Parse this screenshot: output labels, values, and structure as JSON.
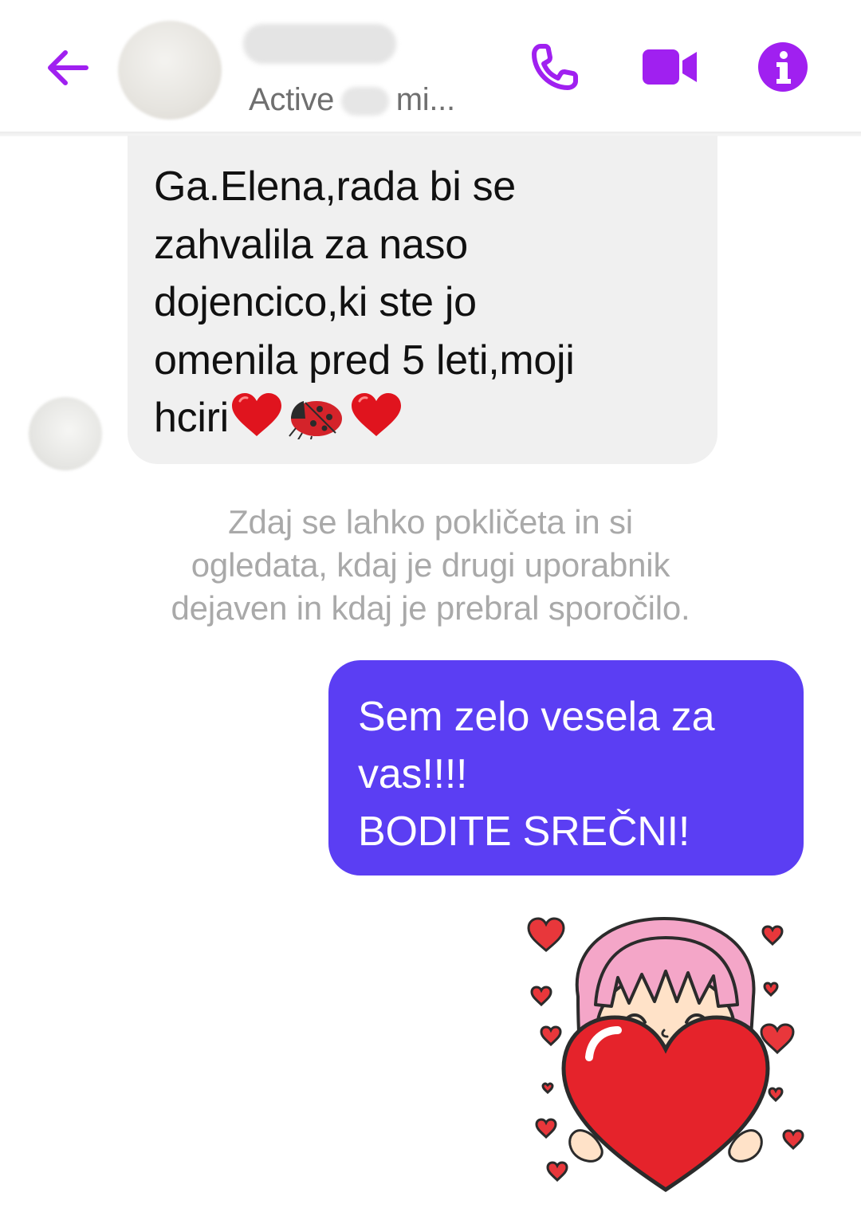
{
  "header": {
    "status_prefix": "Active ",
    "status_suffix": " mi...",
    "icons": [
      "back-arrow-icon",
      "phone-icon",
      "video-camera-icon",
      "info-icon"
    ]
  },
  "colors": {
    "accent": "#a020f0",
    "outgoing_bubble": "#5b3ef3",
    "incoming_bubble": "#f0f0f0",
    "notice_text": "#a9a9a9"
  },
  "messages": {
    "incoming": {
      "text": "Ga.Elena,rada bi se\nzahvalila za naso\ndojencico,ki ste jo\nomenila pred 5 leti,moji\nhciri",
      "emojis": [
        "red-heart",
        "ladybug",
        "red-heart"
      ]
    },
    "notice": "Zdaj se lahko pokličeta in si\nogledata, kdaj je drugi uporabnik\ndejaven in kdaj je prebral sporočilo.",
    "outgoing": {
      "text": "Sem zelo vesela za\nvas!!!!\nBODITE SREČNI!"
    },
    "sticker": "girl-holding-heart-sticker"
  }
}
